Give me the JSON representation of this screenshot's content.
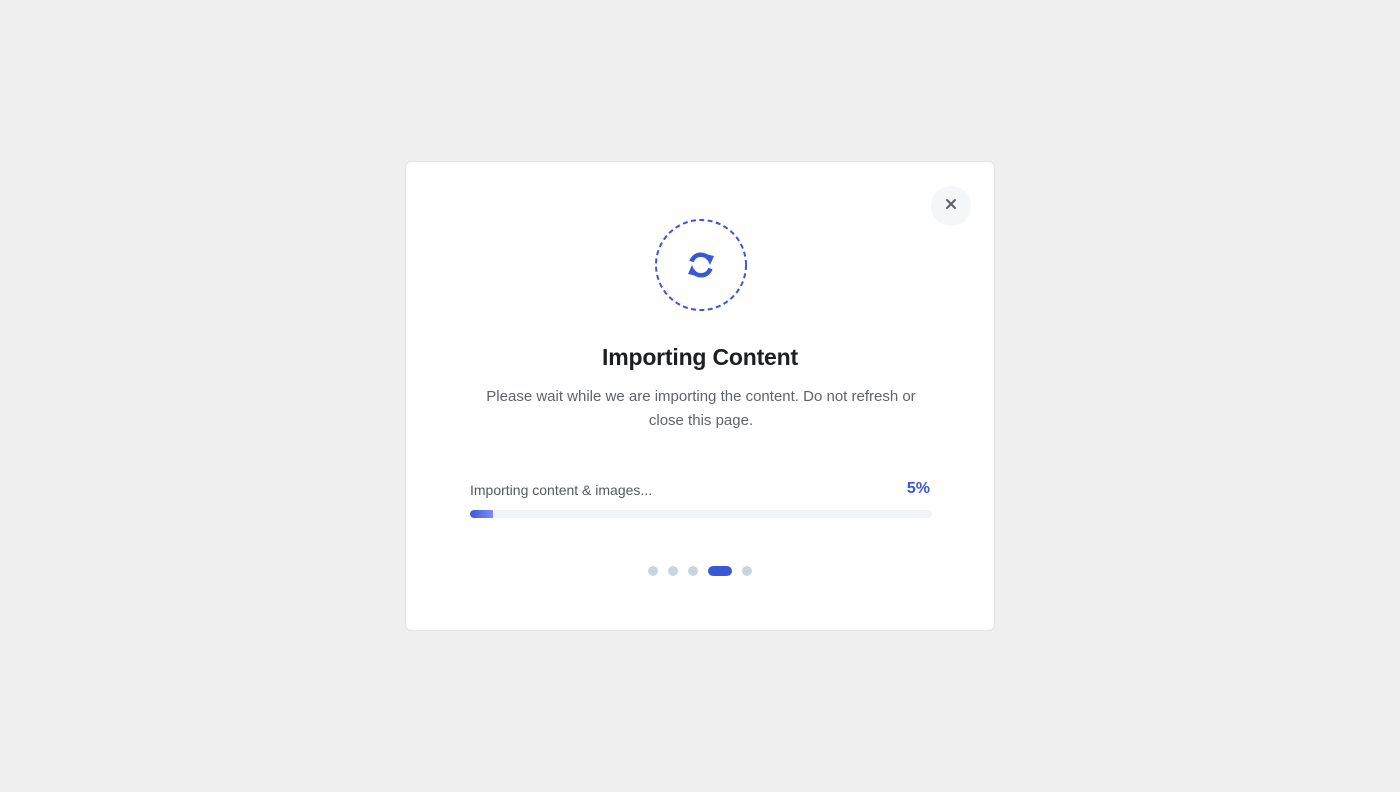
{
  "modal": {
    "close_icon": "close-icon",
    "status_icon": "refresh-icon",
    "accent_color": "#3a57d6",
    "title": "Importing Content",
    "description": "Please wait while we are importing the content. Do not refresh or close this page.",
    "progress": {
      "label": "Importing content & images...",
      "percent_text": "5%",
      "value_percent": 5
    },
    "steps": {
      "count": 5,
      "active_index": 3
    }
  }
}
